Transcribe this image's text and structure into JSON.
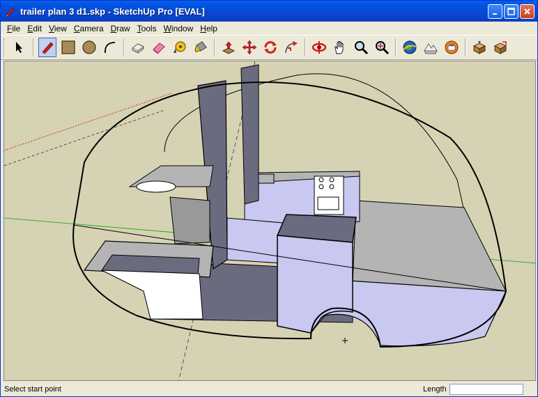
{
  "window": {
    "title": "trailer plan 3 d1.skp - SketchUp Pro [EVAL]"
  },
  "menu": [
    {
      "accel": "F",
      "rest": "ile"
    },
    {
      "accel": "E",
      "rest": "dit"
    },
    {
      "accel": "V",
      "rest": "iew"
    },
    {
      "accel": "C",
      "rest": "amera"
    },
    {
      "accel": "D",
      "rest": "raw"
    },
    {
      "accel": "T",
      "rest": "ools"
    },
    {
      "accel": "W",
      "rest": "indow"
    },
    {
      "accel": "H",
      "rest": "elp"
    }
  ],
  "toolbar": {
    "icons": [
      "select-icon",
      "pencil-icon",
      "rectangle-icon",
      "circle-icon",
      "arc-icon",
      "make-component-icon",
      "eraser-icon",
      "tape-measure-icon",
      "paint-bucket-icon",
      "push-pull-icon",
      "move-icon",
      "rotate-icon",
      "follow-me-icon",
      "orbit-icon",
      "pan-icon",
      "zoom-icon",
      "zoom-extents-icon",
      "google-earth-icon",
      "toggle-terrain-icon",
      "get-models-icon",
      "3d-warehouse-icon",
      "components-icon"
    ],
    "active": "pencil-icon"
  },
  "status": {
    "hint": "Select start point",
    "length_label": "Length",
    "length_value": ""
  },
  "colors": {
    "title_bar": "#0054e3",
    "viewport_bg": "#d6d2b4",
    "face_front": "#c8c8f0",
    "face_dark": "#6b6b80",
    "face_gray": "#b4b4b4",
    "axis_green": "#00aa00",
    "axis_red": "#cc0000"
  }
}
